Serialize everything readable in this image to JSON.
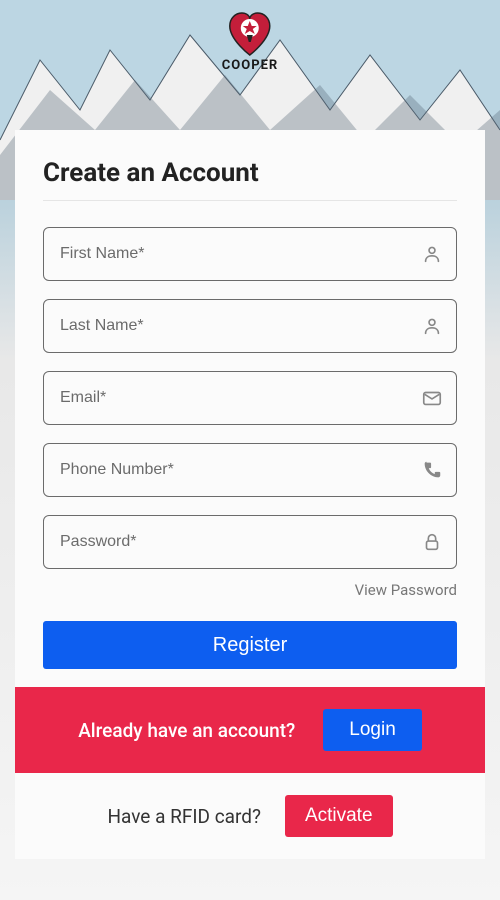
{
  "brand": {
    "name": "COOPER"
  },
  "form": {
    "title": "Create an Account",
    "fields": {
      "first_name": {
        "placeholder": "First Name*",
        "value": ""
      },
      "last_name": {
        "placeholder": "Last Name*",
        "value": ""
      },
      "email": {
        "placeholder": "Email*",
        "value": ""
      },
      "phone": {
        "placeholder": "Phone Number*",
        "value": ""
      },
      "password": {
        "placeholder": "Password*",
        "value": ""
      }
    },
    "view_password_label": "View Password",
    "register_label": "Register"
  },
  "login_bar": {
    "prompt": "Already have an account?",
    "button_label": "Login"
  },
  "activate_bar": {
    "prompt": "Have a RFID card?",
    "button_label": "Activate"
  }
}
